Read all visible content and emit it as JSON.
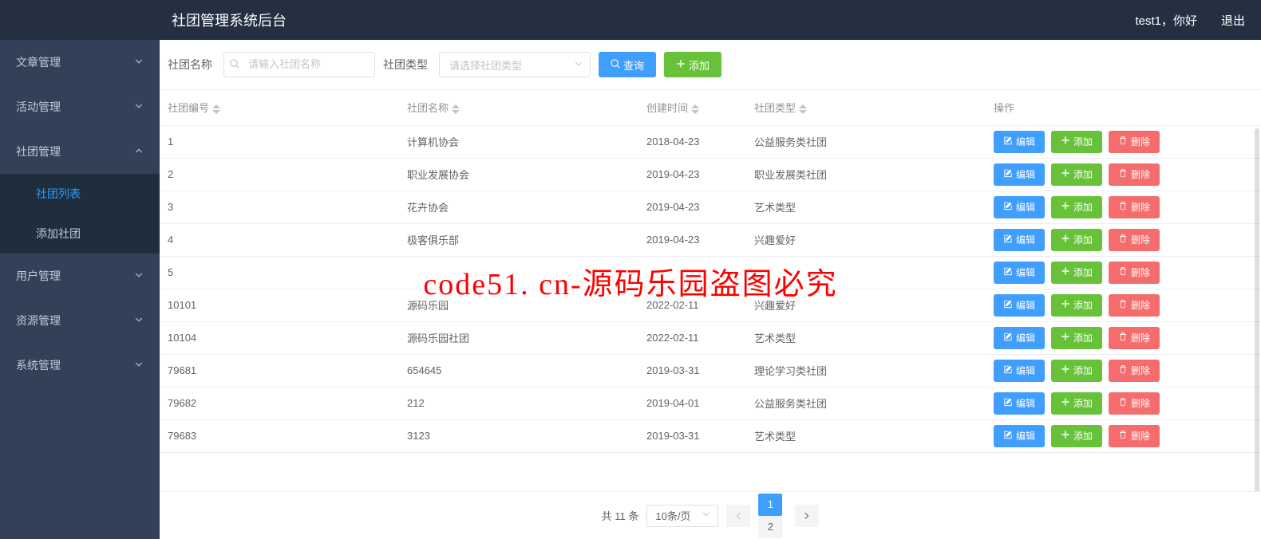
{
  "header": {
    "title": "社团管理系统后台",
    "greeting": "test1，你好",
    "logout": "退出"
  },
  "sidebar": {
    "items": [
      {
        "label": "文章管理",
        "expanded": false
      },
      {
        "label": "活动管理",
        "expanded": false
      },
      {
        "label": "社团管理",
        "expanded": true,
        "children": [
          {
            "label": "社团列表",
            "active": true
          },
          {
            "label": "添加社团",
            "active": false
          }
        ]
      },
      {
        "label": "用户管理",
        "expanded": false
      },
      {
        "label": "资源管理",
        "expanded": false
      },
      {
        "label": "系统管理",
        "expanded": false
      }
    ]
  },
  "filter": {
    "name_label": "社团名称",
    "name_placeholder": "请输入社团名称",
    "type_label": "社团类型",
    "type_placeholder": "请选择社团类型",
    "search_btn": "查询",
    "add_btn": "添加"
  },
  "table": {
    "columns": [
      "社团编号",
      "社团名称",
      "创建时间",
      "社团类型",
      "操作"
    ],
    "actions": {
      "edit": "编辑",
      "add": "添加",
      "delete": "删除"
    },
    "rows": [
      {
        "id": "1",
        "name": "计算机协会",
        "date": "2018-04-23",
        "type": "公益服务类社团"
      },
      {
        "id": "2",
        "name": "职业发展协会",
        "date": "2019-04-23",
        "type": "职业发展类社团"
      },
      {
        "id": "3",
        "name": "花卉协会",
        "date": "2019-04-23",
        "type": "艺术类型"
      },
      {
        "id": "4",
        "name": "极客俱乐部",
        "date": "2019-04-23",
        "type": "兴趣爱好"
      },
      {
        "id": "5",
        "name": "",
        "date": "",
        "type": ""
      },
      {
        "id": "10101",
        "name": "源码乐园",
        "date": "2022-02-11",
        "type": "兴趣爱好"
      },
      {
        "id": "10104",
        "name": "源码乐园社团",
        "date": "2022-02-11",
        "type": "艺术类型"
      },
      {
        "id": "79681",
        "name": "654645",
        "date": "2019-03-31",
        "type": "理论学习类社团"
      },
      {
        "id": "79682",
        "name": "212",
        "date": "2019-04-01",
        "type": "公益服务类社团"
      },
      {
        "id": "79683",
        "name": "3123",
        "date": "2019-03-31",
        "type": "艺术类型"
      }
    ]
  },
  "pagination": {
    "total_text": "共 11 条",
    "page_size": "10条/页",
    "pages": [
      "1",
      "2"
    ],
    "current": 1
  },
  "watermark": "code51. cn-源码乐园盗图必究"
}
